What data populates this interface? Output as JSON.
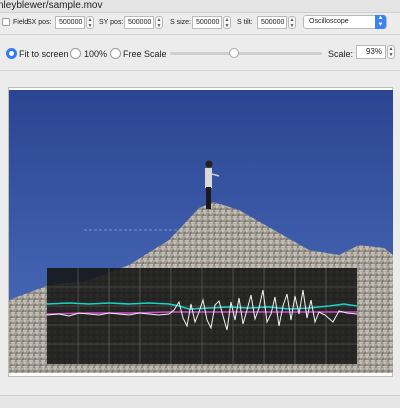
{
  "window": {
    "title": "nleyblewer/sample.mov"
  },
  "controls": {
    "field_label": "Field",
    "sx_pos_label": "SX pos:",
    "sx_pos_value": "500000",
    "sy_pos_label": "SY pos:",
    "sy_pos_value": "500000",
    "s_size_label": "S size:",
    "s_size_value": "500000",
    "s_tilt_label": "S tilt:",
    "s_tilt_value": "500000",
    "mode_select": "Oscilloscope"
  },
  "view": {
    "fit_label": "Fit to screen",
    "hundred_label": "100%",
    "free_label": "Free Scale",
    "selected": "Fit to screen",
    "slider_fraction": 0.42,
    "scale_label": "Scale:",
    "scale_value": "93%"
  },
  "colors": {
    "accent": "#2f7cf6",
    "scope_cyan": "#19d3c5",
    "scope_magenta": "#d24bd0",
    "scope_white": "#f2f2f2",
    "sky": "#2f4f9e"
  },
  "icons": {
    "stepper": "up-down-arrows-icon",
    "select_arrow": "chevron-up-down-icon"
  }
}
